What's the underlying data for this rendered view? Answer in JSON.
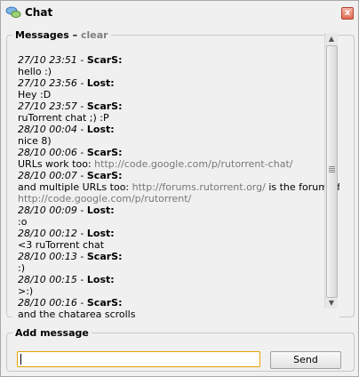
{
  "window": {
    "title": "Chat",
    "close_glyph": "x"
  },
  "messages_panel": {
    "legend": "Messages",
    "separator": "–",
    "clear_label": "clear"
  },
  "messages": [
    {
      "ts": "27/10 23:51",
      "sep": " - ",
      "user": "ScarS",
      "colon": ":"
    },
    {
      "text": "hello :)"
    },
    {
      "ts": "27/10 23:56",
      "sep": " - ",
      "user": "Lost",
      "colon": ":"
    },
    {
      "text": "Hey :D"
    },
    {
      "ts": "27/10 23:57",
      "sep": " - ",
      "user": "ScarS",
      "colon": ":"
    },
    {
      "text": "ruTorrent chat ;) :P"
    },
    {
      "ts": "28/10 00:04",
      "sep": " - ",
      "user": "Lost",
      "colon": ":"
    },
    {
      "text": "nice 8)"
    },
    {
      "ts": "28/10 00:06",
      "sep": " - ",
      "user": "ScarS",
      "colon": ":"
    },
    {
      "text": "URLs work too: ",
      "url": "http://code.google.com/p/rutorrent-chat/"
    },
    {
      "ts": "28/10 00:07",
      "sep": " - ",
      "user": "ScarS",
      "colon": ":"
    },
    {
      "text": "and multiple URLs too: ",
      "url": "http://forums.rutorrent.org/",
      "text2": " is the forum of"
    },
    {
      "url": "http://code.google.com/p/rutorrent/"
    },
    {
      "ts": "28/10 00:09",
      "sep": " - ",
      "user": "Lost",
      "colon": ":"
    },
    {
      "text": ":o"
    },
    {
      "ts": "28/10 00:12",
      "sep": " - ",
      "user": "Lost",
      "colon": ":"
    },
    {
      "text": "<3 ruTorrent chat"
    },
    {
      "ts": "28/10 00:13",
      "sep": " - ",
      "user": "ScarS",
      "colon": ":"
    },
    {
      "text": ":)"
    },
    {
      "ts": "28/10 00:15",
      "sep": " - ",
      "user": "Lost",
      "colon": ":"
    },
    {
      "text": ">:)"
    },
    {
      "ts": "28/10 00:16",
      "sep": " - ",
      "user": "ScarS",
      "colon": ":"
    },
    {
      "text": "and the chatarea scrolls"
    }
  ],
  "add_message": {
    "legend": "Add message",
    "input_value": "",
    "send_label": "Send"
  },
  "colors": {
    "url": "#777777",
    "input_border": "#e5a100"
  }
}
